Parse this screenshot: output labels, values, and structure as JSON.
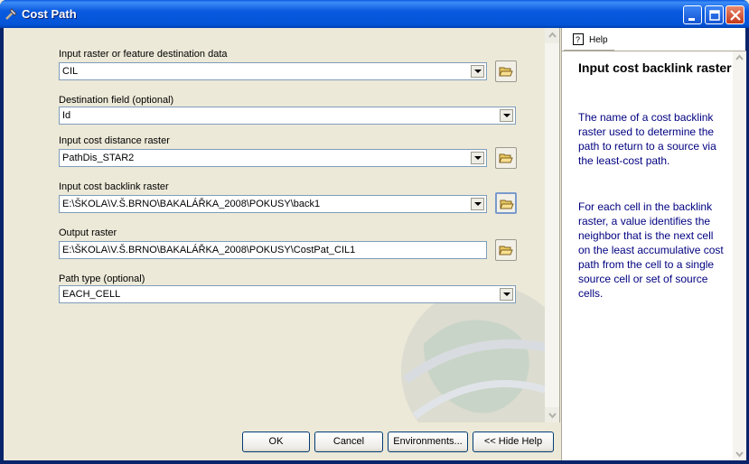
{
  "window": {
    "title": "Cost Path"
  },
  "form": {
    "input_raster_label": "Input raster or feature destination data",
    "input_raster_value": "CIL",
    "destination_field_label": "Destination field (optional)",
    "destination_field_value": "Id",
    "cost_distance_label": "Input cost distance raster",
    "cost_distance_value": "PathDis_STAR2",
    "backlink_label": "Input cost backlink raster",
    "backlink_value": "E:\\ŠKOLA\\V.Š.BRNO\\BAKALÁŘKA_2008\\POKUSY\\back1",
    "output_label": "Output raster",
    "output_value": "E:\\ŠKOLA\\V.Š.BRNO\\BAKALÁŘKA_2008\\POKUSY\\CostPat_CIL1",
    "path_type_label": "Path type (optional)",
    "path_type_value": "EACH_CELL"
  },
  "buttons": {
    "ok": "OK",
    "cancel": "Cancel",
    "environments": "Environments...",
    "hide_help": "<< Hide Help"
  },
  "help": {
    "tab": "Help",
    "title": "Input cost backlink raster",
    "p1": "The name of a cost backlink raster used to determine the path to return to a source via the least-cost path.",
    "p2": "For each cell in the backlink raster, a value identifies the neighbor that is the next cell on the least accumulative cost path from the cell to a single source cell or set of source cells."
  }
}
